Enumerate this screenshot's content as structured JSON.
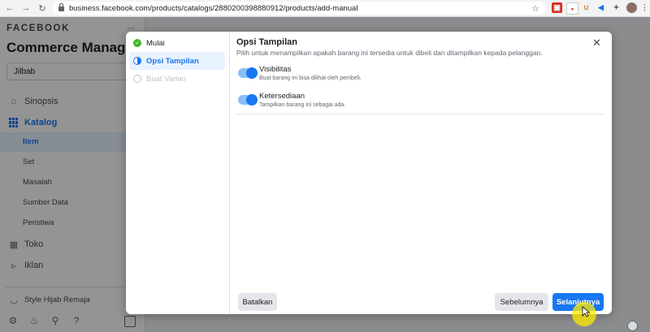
{
  "browser": {
    "url": "business.facebook.com/products/catalogs/2880200398880912/products/add-manual"
  },
  "sidebar": {
    "brand": "FACEBOOK",
    "app_title": "Commerce Manager",
    "catalog_select": "Jilbab",
    "nav": [
      {
        "label": "Sinopsis"
      },
      {
        "label": "Katalog"
      },
      {
        "label": "Item"
      },
      {
        "label": "Set"
      },
      {
        "label": "Masalah"
      },
      {
        "label": "Sumber Data"
      },
      {
        "label": "Peristiwa"
      },
      {
        "label": "Toko"
      },
      {
        "label": "Iklan"
      }
    ],
    "account": "Style Hijab Remaja"
  },
  "modal": {
    "steps": [
      {
        "label": "Mulai",
        "state": "done"
      },
      {
        "label": "Opsi Tampilan",
        "state": "active"
      },
      {
        "label": "Buat Varian",
        "state": "pending"
      }
    ],
    "title": "Opsi Tampilan",
    "subtitle": "Pilih untuk menampilkan apakah barang ini tersedia untuk dibeli dan ditampilkan kepada pelanggan.",
    "options": [
      {
        "label": "Visibilitas",
        "description": "Buat barang ini bisa dilihat oleh pembeli.",
        "enabled": true
      },
      {
        "label": "Ketersediaan",
        "description": "Tampilkan barang ini sebagai ada.",
        "enabled": true
      }
    ],
    "buttons": {
      "cancel": "Batalkan",
      "back": "Sebelumnya",
      "next": "Selanjutnya"
    }
  },
  "colors": {
    "accent": "#1877f2",
    "done": "#42b72a",
    "cursor_highlight": "#ffeb00"
  }
}
